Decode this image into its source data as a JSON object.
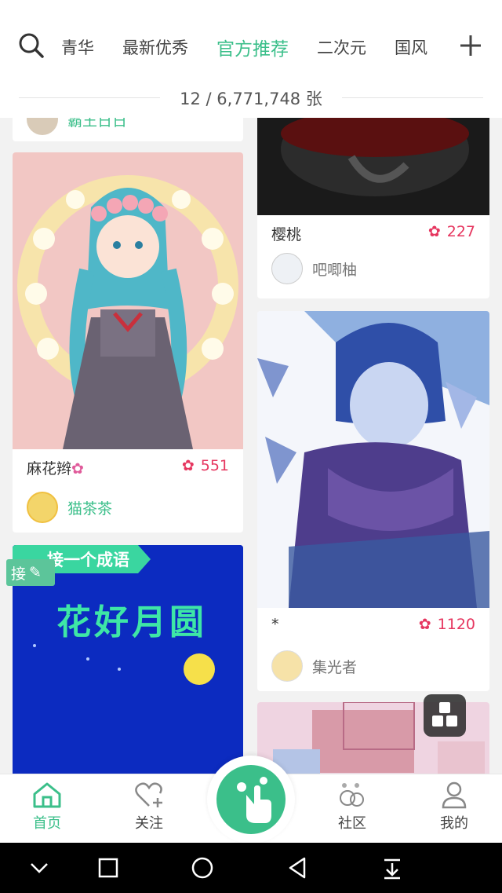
{
  "header": {
    "tabs": [
      {
        "label": "青华"
      },
      {
        "label": "最新优秀"
      },
      {
        "label": "官方推荐"
      },
      {
        "label": "二次元"
      },
      {
        "label": "国风"
      }
    ],
    "counter": "12 / 6,771,748 张",
    "accent": "#3bbf8a"
  },
  "feed": {
    "top_left_card": {
      "author": "霸王日日"
    },
    "cards": [
      {
        "title": "麻花辫",
        "likes": "551",
        "author": "猫茶茶"
      },
      {
        "title": "樱桃",
        "likes": "227",
        "author": "吧唧柚"
      },
      {
        "title": "*",
        "likes": "1120",
        "author": "集光者"
      }
    ],
    "relay_card": {
      "banner": "接一个成语",
      "text": "花好月圆",
      "tag": "接"
    }
  },
  "bottom_nav": {
    "items": [
      {
        "label": "首页",
        "icon": "home-icon"
      },
      {
        "label": "关注",
        "icon": "heart-plus-icon"
      },
      {
        "label": "社区",
        "icon": "bubbles-icon"
      },
      {
        "label": "我的",
        "icon": "user-icon"
      }
    ]
  },
  "colors": {
    "like": "#e6365f",
    "accent": "#3bbf8a"
  }
}
